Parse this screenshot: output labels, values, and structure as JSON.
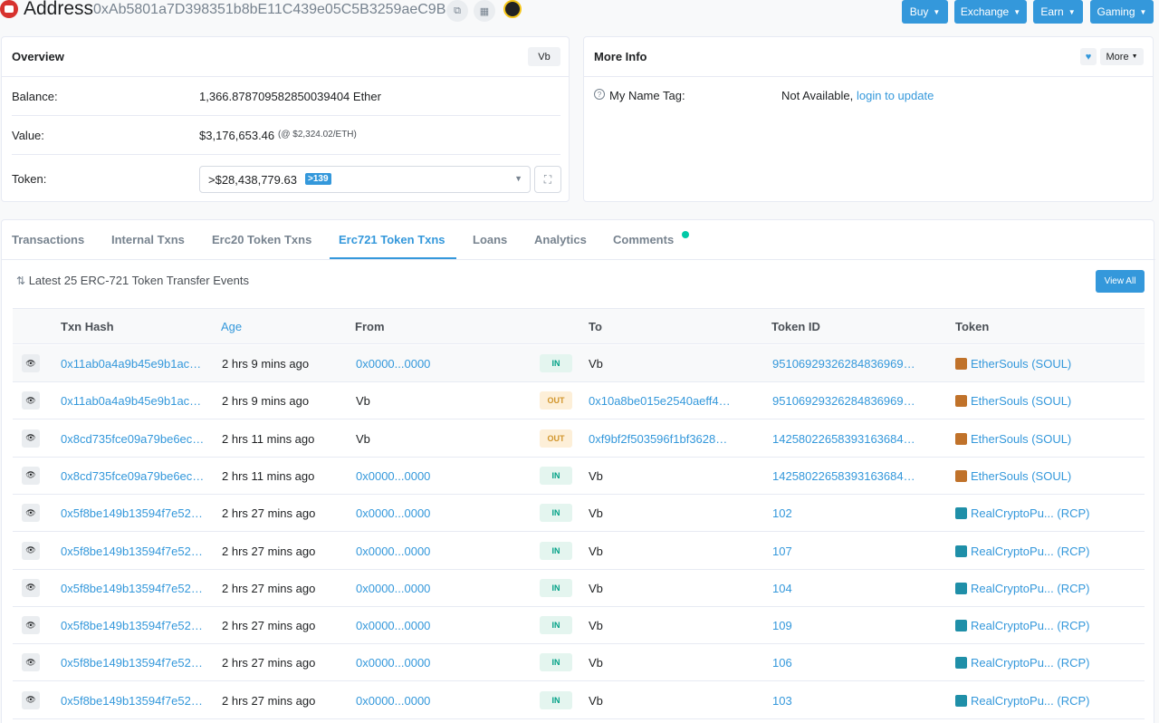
{
  "header": {
    "title": "Address",
    "address": "0xAb5801a7D398351b8bE11C439e05C5B3259aeC9B",
    "nav": [
      {
        "label": "Buy"
      },
      {
        "label": "Exchange"
      },
      {
        "label": "Earn"
      },
      {
        "label": "Gaming"
      }
    ]
  },
  "overview": {
    "title": "Overview",
    "badge": "Vb",
    "balance_label": "Balance:",
    "balance_value": "1,366.878709582850039404 Ether",
    "value_label": "Value:",
    "value_amount": "$3,176,653.46",
    "value_rate": "(@ $2,324.02/ETH)",
    "token_label": "Token:",
    "token_amount": ">$28,438,779.63",
    "token_count": ">139"
  },
  "more_info": {
    "title": "More Info",
    "more_label": "More",
    "name_tag_label": "My Name Tag:",
    "name_tag_value": "Not Available,",
    "name_tag_link": "login to update"
  },
  "tabs": [
    {
      "label": "Transactions"
    },
    {
      "label": "Internal Txns"
    },
    {
      "label": "Erc20 Token Txns"
    },
    {
      "label": "Erc721 Token Txns",
      "active": true
    },
    {
      "label": "Loans"
    },
    {
      "label": "Analytics"
    },
    {
      "label": "Comments"
    }
  ],
  "events": {
    "summary": "Latest 25 ERC-721 Token Transfer Events",
    "view_all": "View All"
  },
  "table": {
    "columns": [
      "Txn Hash",
      "Age",
      "From",
      "To",
      "Token ID",
      "Token"
    ],
    "rows": [
      {
        "hash": "0x11ab0a4a9b45e9b1ac…",
        "age": "2 hrs 9 mins ago",
        "from": "0x0000...0000",
        "dir": "IN",
        "to": "Vb",
        "token_id": "95106929326284836969…",
        "token": "EtherSouls (SOUL)",
        "icon": "ethersouls"
      },
      {
        "hash": "0x11ab0a4a9b45e9b1ac…",
        "age": "2 hrs 9 mins ago",
        "from": "Vb",
        "dir": "OUT",
        "to": "0x10a8be015e2540aeff4…",
        "token_id": "95106929326284836969…",
        "token": "EtherSouls (SOUL)",
        "icon": "ethersouls"
      },
      {
        "hash": "0x8cd735fce09a79be6ec…",
        "age": "2 hrs 11 mins ago",
        "from": "Vb",
        "dir": "OUT",
        "to": "0xf9bf2f503596f1bf3628…",
        "token_id": "14258022658393163684…",
        "token": "EtherSouls (SOUL)",
        "icon": "ethersouls"
      },
      {
        "hash": "0x8cd735fce09a79be6ec…",
        "age": "2 hrs 11 mins ago",
        "from": "0x0000...0000",
        "dir": "IN",
        "to": "Vb",
        "token_id": "14258022658393163684…",
        "token": "EtherSouls (SOUL)",
        "icon": "ethersouls"
      },
      {
        "hash": "0x5f8be149b13594f7e52…",
        "age": "2 hrs 27 mins ago",
        "from": "0x0000...0000",
        "dir": "IN",
        "to": "Vb",
        "token_id": "102",
        "token": "RealCryptoPu... (RCP)",
        "icon": "realcryptopunks"
      },
      {
        "hash": "0x5f8be149b13594f7e52…",
        "age": "2 hrs 27 mins ago",
        "from": "0x0000...0000",
        "dir": "IN",
        "to": "Vb",
        "token_id": "107",
        "token": "RealCryptoPu... (RCP)",
        "icon": "realcryptopunks"
      },
      {
        "hash": "0x5f8be149b13594f7e52…",
        "age": "2 hrs 27 mins ago",
        "from": "0x0000...0000",
        "dir": "IN",
        "to": "Vb",
        "token_id": "104",
        "token": "RealCryptoPu... (RCP)",
        "icon": "realcryptopunks"
      },
      {
        "hash": "0x5f8be149b13594f7e52…",
        "age": "2 hrs 27 mins ago",
        "from": "0x0000...0000",
        "dir": "IN",
        "to": "Vb",
        "token_id": "109",
        "token": "RealCryptoPu... (RCP)",
        "icon": "realcryptopunks"
      },
      {
        "hash": "0x5f8be149b13594f7e52…",
        "age": "2 hrs 27 mins ago",
        "from": "0x0000...0000",
        "dir": "IN",
        "to": "Vb",
        "token_id": "106",
        "token": "RealCryptoPu... (RCP)",
        "icon": "realcryptopunks"
      },
      {
        "hash": "0x5f8be149b13594f7e52…",
        "age": "2 hrs 27 mins ago",
        "from": "0x0000...0000",
        "dir": "IN",
        "to": "Vb",
        "token_id": "103",
        "token": "RealCryptoPu... (RCP)",
        "icon": "realcryptopunks"
      }
    ]
  },
  "colors": {
    "accent": "#3498db",
    "in_badge": "#00a186",
    "out_badge": "#d1952b",
    "ethersouls_icon": "#c0722a",
    "realcryptopunks_icon": "#1f8fa8"
  }
}
